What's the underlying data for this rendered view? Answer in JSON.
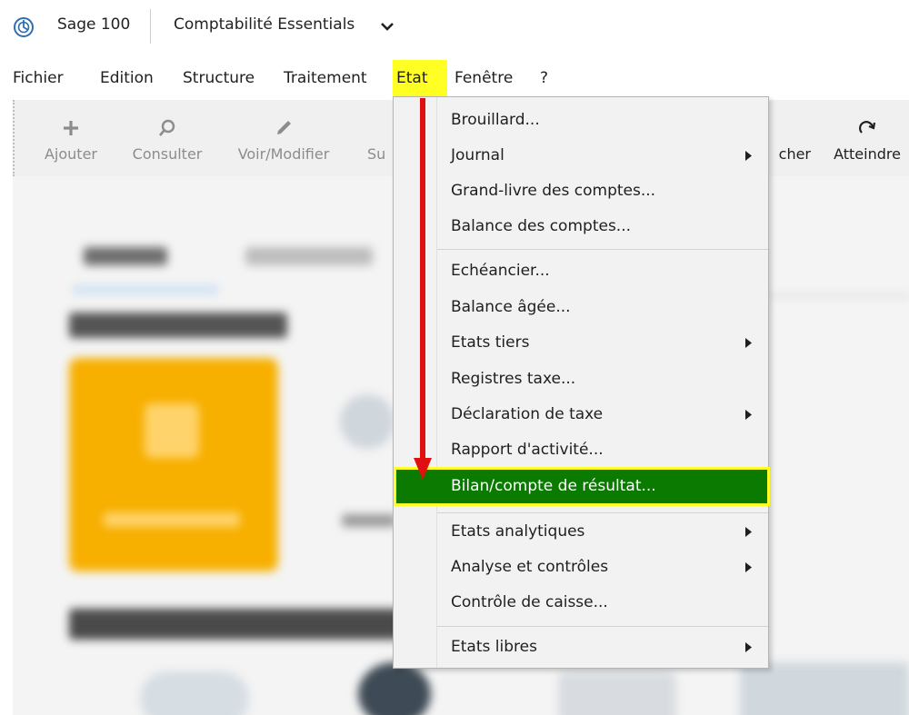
{
  "titlebar": {
    "app_name": "Sage 100",
    "product_name": "Comptabilité Essentials",
    "logo_icon": "sage-logo-icon",
    "chevron_icon": "chevron-down-icon"
  },
  "menubar": {
    "items": [
      {
        "label": "Fichier"
      },
      {
        "label": "Edition"
      },
      {
        "label": "Structure"
      },
      {
        "label": "Traitement"
      },
      {
        "label": "Etat",
        "active": true
      },
      {
        "label": "Fenêtre"
      },
      {
        "label": "?"
      }
    ],
    "active_color": "#ffff24"
  },
  "toolbar": {
    "items": [
      {
        "label": "Ajouter",
        "icon": "plus-icon"
      },
      {
        "label": "Consulter",
        "icon": "search-icon"
      },
      {
        "label": "Voir/Modifier",
        "icon": "pencil-icon"
      },
      {
        "label": "Su"
      },
      {
        "label": "cher"
      },
      {
        "label": "Atteindre",
        "icon": "redo-icon"
      }
    ]
  },
  "dropdown": {
    "items": [
      {
        "label": "Brouillard...",
        "submenu": false
      },
      {
        "label": "Journal",
        "submenu": true
      },
      {
        "label": "Grand-livre des comptes...",
        "submenu": false
      },
      {
        "label": "Balance des comptes...",
        "submenu": false
      },
      {
        "label": "Echéancier...",
        "submenu": false
      },
      {
        "label": "Balance âgée...",
        "submenu": false
      },
      {
        "label": "Etats tiers",
        "submenu": true
      },
      {
        "label": "Registres taxe...",
        "submenu": false
      },
      {
        "label": "Déclaration de taxe",
        "submenu": true
      },
      {
        "label": "Rapport d'activité...",
        "submenu": false
      },
      {
        "label": "Bilan/compte de résultat...",
        "submenu": false,
        "highlighted": true
      },
      {
        "label": "Etats analytiques",
        "submenu": true
      },
      {
        "label": "Analyse et contrôles",
        "submenu": true
      },
      {
        "label": "Contrôle de caisse...",
        "submenu": false
      },
      {
        "label": "Etats libres",
        "submenu": true
      }
    ],
    "highlight_color": "#0a7a00",
    "highlight_border_color": "#ffff24"
  },
  "annotation": {
    "arrow_color": "#e01010"
  }
}
